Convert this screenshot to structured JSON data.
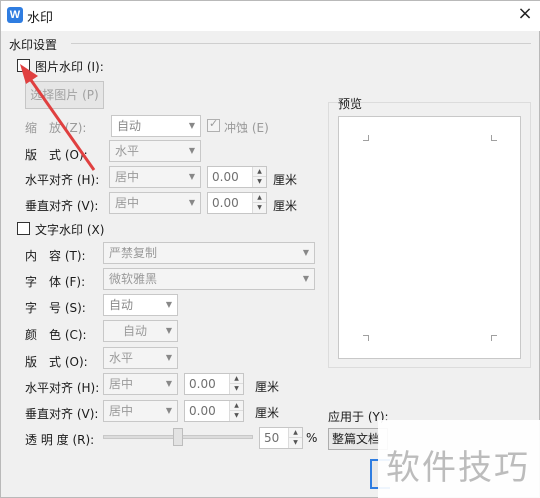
{
  "window": {
    "title": "水印",
    "app_icon_letter": "W",
    "close": "×"
  },
  "watermark_settings_title": "水印设置",
  "picture_watermark": {
    "checkbox_label": "图片水印 (I):",
    "select_button": "选择图片 (P)",
    "scale_label": "缩　放 (Z):",
    "scale_value": "自动",
    "washout_label": "冲蚀 (E)",
    "layout_label": "版　式 (O):",
    "layout_value": "水平",
    "h_align_label": "水平对齐 (H):",
    "h_align_value": "居中",
    "h_offset": "0.00",
    "h_unit": "厘米",
    "v_align_label": "垂直对齐 (V):",
    "v_align_value": "居中",
    "v_offset": "0.00",
    "v_unit": "厘米"
  },
  "text_watermark": {
    "checkbox_label": "文字水印 (X)",
    "content_label": "内　容 (T):",
    "content_value": "严禁复制",
    "font_label": "字　体 (F):",
    "font_value": "微软雅黑",
    "size_label": "字　号 (S):",
    "size_value": "自动",
    "color_label": "颜　色 (C):",
    "color_value": "自动",
    "layout_label": "版　式 (O):",
    "layout_value": "水平",
    "h_align_label": "水平对齐 (H):",
    "h_align_value": "居中",
    "h_offset": "0.00",
    "h_unit": "厘米",
    "v_align_label": "垂直对齐 (V):",
    "v_align_value": "居中",
    "v_offset": "0.00",
    "v_unit": "厘米",
    "transparency_label": "透 明 度 (R):",
    "transparency_value": "50",
    "transparency_unit": "%"
  },
  "preview": {
    "title": "预览"
  },
  "apply": {
    "label": "应用于 (Y):",
    "value": "整篇文档"
  },
  "overlay_watermark": "软件技巧",
  "colors": {
    "accent": "#2f7de1",
    "arrow": "#e04040"
  }
}
